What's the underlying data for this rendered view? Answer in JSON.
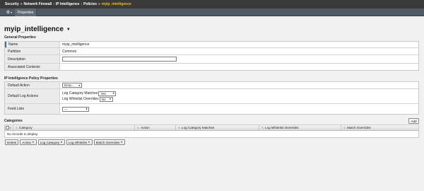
{
  "breadcrumb": [
    "Security",
    "Network Firewall",
    "IP Intelligence",
    "Policies",
    "myip_intelligence"
  ],
  "breadcrumb_separators": [
    "»",
    ":",
    ":",
    "»"
  ],
  "tab": "Properties",
  "page_title": "myip_intelligence",
  "general": {
    "title": "General Properties",
    "name_label": "Name",
    "name_value": "myip_intelligence",
    "partition_label": "Partition",
    "partition_value": "Common",
    "description_label": "Description",
    "description_value": "",
    "associated_label": "Associated Contexts",
    "associated_value": ""
  },
  "policy": {
    "title": "IP Intelligence Policy Properties",
    "default_action_label": "Default Action",
    "default_action_value": "Drop...",
    "default_log_label": "Default Log Actions",
    "log_category_label": "Log Category Matches",
    "log_category_value": "Yes",
    "log_whitelist_label": "Log Whitelist Overrides",
    "log_whitelist_value": "No",
    "feed_lists_label": "Feed Lists",
    "feed_lists_value": "---"
  },
  "categories": {
    "title": "Categories",
    "add_label": "Add",
    "columns": [
      "Category",
      "Action",
      "Log Category Matches",
      "Log Whitelist Overrides",
      "Match Overrides"
    ],
    "empty_text": "No records to display."
  },
  "actions": {
    "delete": "Delete",
    "action": "Action",
    "log_category": "Log Category",
    "log_whitelist": "Log Whitelist",
    "match_overrides": "Match Overrides"
  },
  "colors": {
    "topbar": "#3a3a3a",
    "tabbar": "#505a64",
    "active_crumb": "#f0c000",
    "accent": "#3e6ea1"
  }
}
